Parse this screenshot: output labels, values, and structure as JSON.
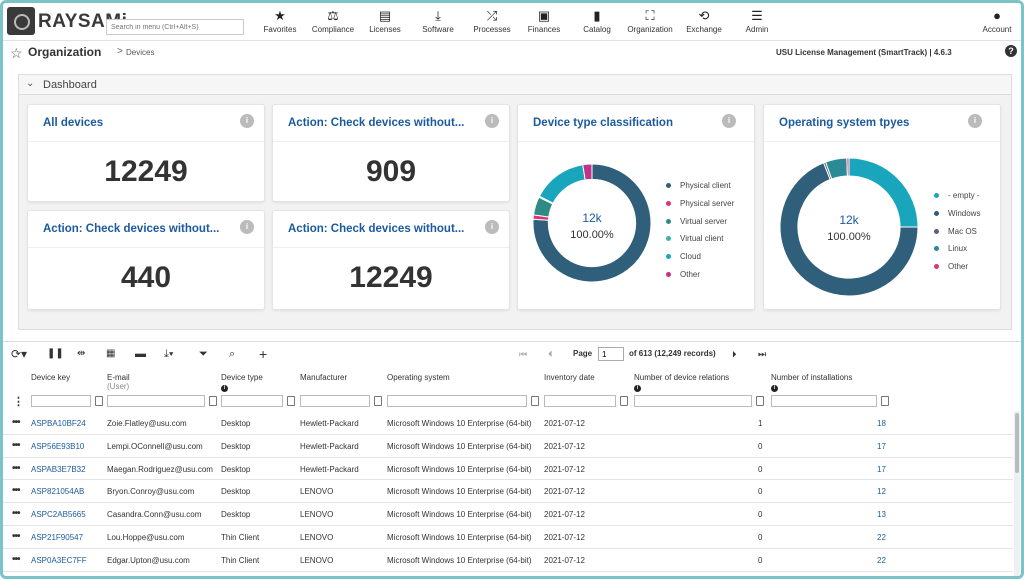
{
  "brand": {
    "name": "RAYSAMi"
  },
  "search": {
    "placeholder": "Search in menu (Ctrl+Alt+S)"
  },
  "nav": [
    {
      "label": "Favorites",
      "icon": "star-icon",
      "glyph": "★"
    },
    {
      "label": "Compliance",
      "icon": "scale-icon",
      "glyph": "⚖"
    },
    {
      "label": "Licenses",
      "icon": "document-icon",
      "glyph": "▤"
    },
    {
      "label": "Software",
      "icon": "download-icon",
      "glyph": "⤓"
    },
    {
      "label": "Processes",
      "icon": "shuffle-icon",
      "glyph": "⤮"
    },
    {
      "label": "Finances",
      "icon": "money-icon",
      "glyph": "▣"
    },
    {
      "label": "Catalog",
      "icon": "book-icon",
      "glyph": "▮"
    },
    {
      "label": "Organization",
      "icon": "org-chart-icon",
      "glyph": "⛶"
    },
    {
      "label": "Exchange",
      "icon": "repeat-icon",
      "glyph": "⟲"
    },
    {
      "label": "Admin",
      "icon": "sliders-icon",
      "glyph": "☰"
    }
  ],
  "account": {
    "label": "Account",
    "glyph": "●"
  },
  "breadcrumb": {
    "title": "Organization",
    "separator": ">",
    "current": "Devices"
  },
  "version": "USU License Management (SmartTrack) | 4.6.3",
  "help": "?",
  "dashboard": {
    "title": "Dashboard",
    "cards": [
      {
        "title": "All devices",
        "value": "12249"
      },
      {
        "title": "Action: Check devices without...",
        "value": "909"
      },
      {
        "title": "Action: Check devices without...",
        "value": "440"
      },
      {
        "title": "Action: Check devices without...",
        "value": "12249"
      }
    ],
    "donuts": [
      {
        "title": "Device type classification",
        "center_value": "12k",
        "center_pct": "100.00%",
        "legend": [
          {
            "label": "Physical client",
            "color": "#2f5f7a",
            "value": 76
          },
          {
            "label": "Physical server",
            "color": "#e0337a",
            "value": 1.2
          },
          {
            "label": "Virtual server",
            "color": "#2e8b84",
            "value": 5
          },
          {
            "label": "Virtual client",
            "color": "#38b3a6",
            "value": 0.3
          },
          {
            "label": "Cloud",
            "color": "#19a6bd",
            "value": 15
          },
          {
            "label": "Other",
            "color": "#c0338a",
            "value": 2.5
          }
        ]
      },
      {
        "title": "Operating system tpyes",
        "center_value": "12k",
        "center_pct": "100.00%",
        "legend": [
          {
            "label": "- empty -",
            "color": "#19a6bd",
            "value": 25
          },
          {
            "label": "Windows",
            "color": "#2f5f7a",
            "value": 69
          },
          {
            "label": "Mac OS",
            "color": "#5a5f80",
            "value": 0.5
          },
          {
            "label": "Linux",
            "color": "#2a8a96",
            "value": 5
          },
          {
            "label": "Other",
            "color": "#e0337a",
            "value": 0.5
          }
        ]
      }
    ]
  },
  "pager": {
    "page_label": "Page",
    "page": "1",
    "of_text": "of 613 (12,249 records)"
  },
  "table": {
    "columns": [
      {
        "label": "Device key",
        "sub": ""
      },
      {
        "label": "E-mail",
        "sub": "(User)"
      },
      {
        "label": "Device type",
        "sub": ""
      },
      {
        "label": "Manufacturer",
        "sub": ""
      },
      {
        "label": "Operating system",
        "sub": ""
      },
      {
        "label": "Inventory date",
        "sub": ""
      },
      {
        "label": "Number of device relations",
        "sub": ""
      },
      {
        "label": "Number of installations",
        "sub": ""
      }
    ],
    "rows": [
      {
        "key": "ASPBA10BF24",
        "email": "Zoie.Flatley@usu.com",
        "type": "Desktop",
        "mfr": "Hewlett-Packard",
        "os": "Microsoft Windows 10 Enterprise (64-bit)",
        "date": "2021-07-12",
        "rel": "1",
        "inst": "18"
      },
      {
        "key": "ASP56E93B10",
        "email": "Lempi.OConnell@usu.com",
        "type": "Desktop",
        "mfr": "Hewlett-Packard",
        "os": "Microsoft Windows 10 Enterprise (64-bit)",
        "date": "2021-07-12",
        "rel": "0",
        "inst": "17"
      },
      {
        "key": "ASPAB3E7B32",
        "email": "Maegan.Rodriguez@usu.com",
        "type": "Desktop",
        "mfr": "Hewlett-Packard",
        "os": "Microsoft Windows 10 Enterprise (64-bit)",
        "date": "2021-07-12",
        "rel": "0",
        "inst": "17"
      },
      {
        "key": "ASP821054AB",
        "email": "Bryon.Conroy@usu.com",
        "type": "Desktop",
        "mfr": "LENOVO",
        "os": "Microsoft Windows 10 Enterprise (64-bit)",
        "date": "2021-07-12",
        "rel": "0",
        "inst": "12"
      },
      {
        "key": "ASPC2AB5665",
        "email": "Casandra.Conn@usu.com",
        "type": "Desktop",
        "mfr": "LENOVO",
        "os": "Microsoft Windows 10 Enterprise (64-bit)",
        "date": "2021-07-12",
        "rel": "0",
        "inst": "13"
      },
      {
        "key": "ASP21F90547",
        "email": "Lou.Hoppe@usu.com",
        "type": "Thin Client",
        "mfr": "LENOVO",
        "os": "Microsoft Windows 10 Enterprise (64-bit)",
        "date": "2021-07-12",
        "rel": "0",
        "inst": "22"
      },
      {
        "key": "ASP0A3EC7FF",
        "email": "Edgar.Upton@usu.com",
        "type": "Thin Client",
        "mfr": "LENOVO",
        "os": "Microsoft Windows 10 Enterprise (64-bit)",
        "date": "2021-07-12",
        "rel": "0",
        "inst": "22"
      }
    ]
  }
}
